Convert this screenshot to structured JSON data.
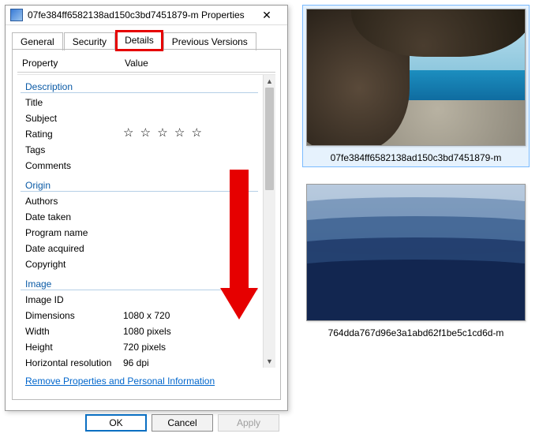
{
  "dialog": {
    "title": "07fe384ff6582138ad150c3bd7451879-m Properties",
    "tabs": {
      "general": "General",
      "security": "Security",
      "details": "Details",
      "previous": "Previous Versions"
    },
    "headers": {
      "property": "Property",
      "value": "Value"
    },
    "sections": {
      "description": "Description",
      "origin": "Origin",
      "image": "Image"
    },
    "desc": {
      "title_k": "Title",
      "subject_k": "Subject",
      "rating_k": "Rating",
      "tags_k": "Tags",
      "comments_k": "Comments"
    },
    "origin": {
      "authors_k": "Authors",
      "date_taken_k": "Date taken",
      "program_k": "Program name",
      "date_acq_k": "Date acquired",
      "copyright_k": "Copyright"
    },
    "image": {
      "id_k": "Image ID",
      "dimensions_k": "Dimensions",
      "dimensions_v": "1080 x 720",
      "width_k": "Width",
      "width_v": "1080 pixels",
      "height_k": "Height",
      "height_v": "720 pixels",
      "hres_k": "Horizontal resolution",
      "hres_v": "96 dpi"
    },
    "link": "Remove Properties and Personal Information",
    "buttons": {
      "ok": "OK",
      "cancel": "Cancel",
      "apply": "Apply"
    },
    "stars": "☆ ☆ ☆ ☆ ☆"
  },
  "thumbs": {
    "a": "07fe384ff6582138ad150c3bd7451879-m",
    "b": "764dda767d96e3a1abd62f1be5c1cd6d-m"
  }
}
